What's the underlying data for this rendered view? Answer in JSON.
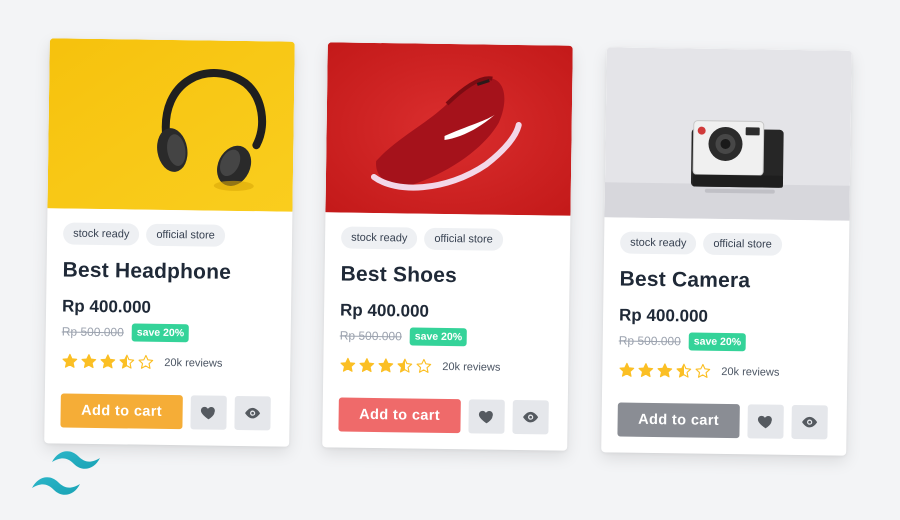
{
  "products": [
    {
      "image_icon": "headphone-image",
      "chips": [
        "stock ready",
        "official store"
      ],
      "title": "Best Headphone",
      "price": "Rp 400.000",
      "old_price": "Rp 500.000",
      "discount": "save 20%",
      "rating": 3.5,
      "reviews": "20k reviews",
      "cart_label": "Add to cart",
      "accent": "#f5ad37"
    },
    {
      "image_icon": "shoe-image",
      "chips": [
        "stock ready",
        "official store"
      ],
      "title": "Best Shoes",
      "price": "Rp 400.000",
      "old_price": "Rp 500.000",
      "discount": "save 20%",
      "rating": 3.5,
      "reviews": "20k reviews",
      "cart_label": "Add to cart",
      "accent": "#ef6a6a"
    },
    {
      "image_icon": "camera-image",
      "chips": [
        "stock ready",
        "official store"
      ],
      "title": "Best Camera",
      "price": "Rp 400.000",
      "old_price": "Rp 500.000",
      "discount": "save 20%",
      "rating": 3.5,
      "reviews": "20k reviews",
      "cart_label": "Add to cart",
      "accent": "#8a8d94"
    }
  ],
  "colors": {
    "background": "#f3f4f6",
    "save_badge": "#34d399",
    "star": "#fbbf24"
  },
  "logo": "tailwind-logo-icon"
}
